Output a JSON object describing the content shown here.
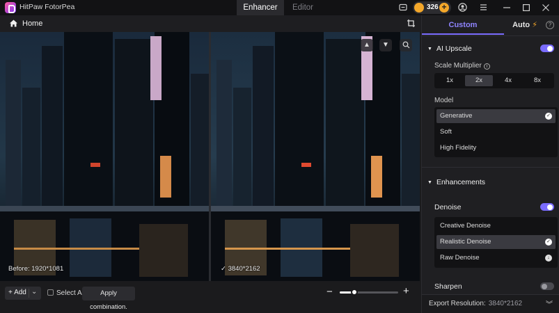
{
  "app": {
    "name": "HitPaw FotorPea",
    "tabs": [
      {
        "label": "Enhancer",
        "active": true
      },
      {
        "label": "Editor",
        "active": false
      }
    ],
    "credits": "326",
    "accent": "#7a6cff"
  },
  "header": {
    "home_label": "Home"
  },
  "viewer": {
    "before_label": "Before: 1920*1081",
    "after_label": "3840*2162"
  },
  "toolbar": {
    "add_label": "+ Add",
    "select_all_label": "Select All",
    "apply_label": "Apply combination.",
    "zoom_level": 0.25
  },
  "panel": {
    "tabs": [
      {
        "label": "Custom",
        "active": true
      },
      {
        "label": "Auto",
        "active": false
      }
    ],
    "ai_upscale": {
      "title": "AI Upscale",
      "enabled": true,
      "scale_label": "Scale Multiplier",
      "scales": [
        "1x",
        "2x",
        "4x",
        "8x"
      ],
      "selected_scale": "2x",
      "model_label": "Model",
      "models": [
        "Generative",
        "Soft",
        "High Fidelity"
      ],
      "selected_model": "Generative"
    },
    "enhancements": {
      "title": "Enhancements",
      "denoise_label": "Denoise",
      "denoise_enabled": true,
      "denoise_options": [
        "Creative Denoise",
        "Realistic Denoise",
        "Raw Denoise"
      ],
      "selected_denoise": "Realistic Denoise",
      "sharpen_label": "Sharpen",
      "sharpen_enabled": false
    },
    "export": {
      "label": "Export Resolution:",
      "value": "3840*2162"
    }
  }
}
